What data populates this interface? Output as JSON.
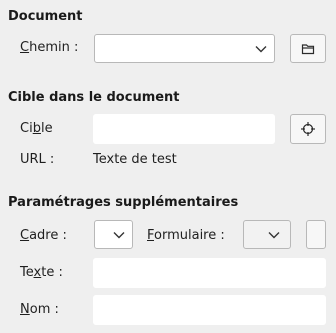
{
  "document": {
    "title": "Document",
    "path_label_pre": "",
    "path_label_accel": "C",
    "path_label_post": "hemin :",
    "path_value": "",
    "open_file_icon": "folder-icon"
  },
  "target": {
    "title": "Cible dans le document",
    "target_label_pre": "Ci",
    "target_label_accel": "b",
    "target_label_post": "le",
    "target_value": "",
    "target_icon": "crosshair-icon",
    "url_label": "URL :",
    "url_value": "Texte de test"
  },
  "further": {
    "title": "Paramétrages supplémentaires",
    "frame_label_pre": "",
    "frame_label_accel": "C",
    "frame_label_post": "adre :",
    "frame_value": "",
    "form_label_pre": "",
    "form_label_accel": "F",
    "form_label_post": "ormulaire :",
    "form_value": "",
    "text_label_pre": "Te",
    "text_label_accel": "x",
    "text_label_post": "te :",
    "text_value": "",
    "name_label_pre": "",
    "name_label_accel": "N",
    "name_label_post": "om :",
    "name_value": ""
  },
  "colors": {
    "background": "#efefef",
    "field": "#ffffff",
    "border": "#b8b8b8"
  }
}
